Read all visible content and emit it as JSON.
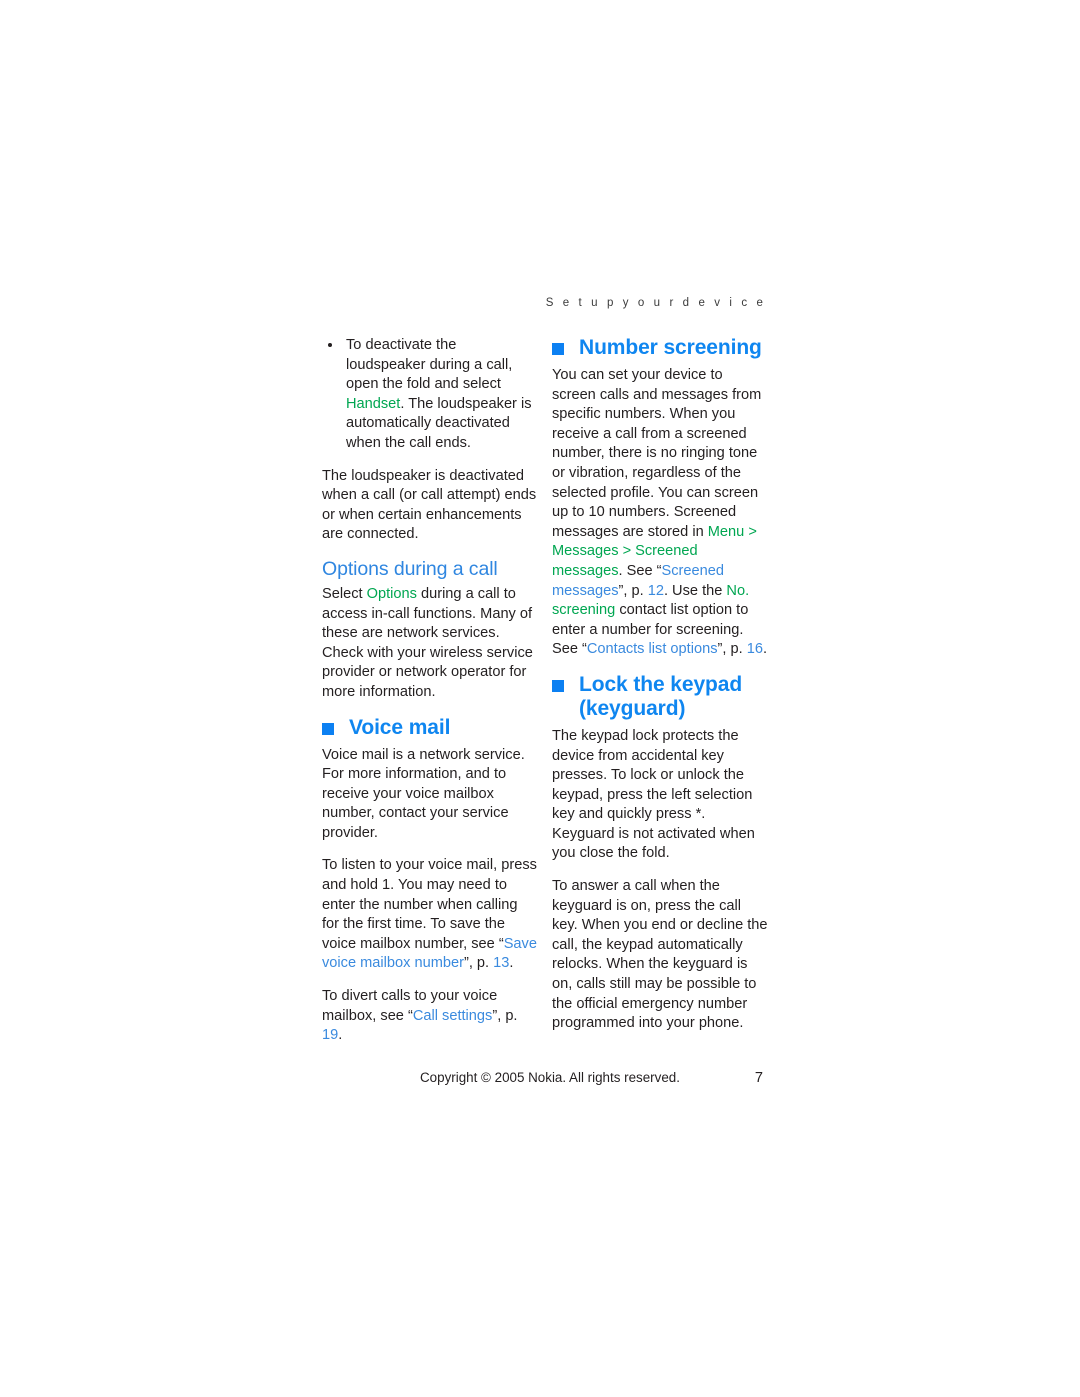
{
  "page": {
    "running_header": "S e t   u p   y o u r   d e v i c e",
    "number": "7",
    "copyright": "Copyright © 2005 Nokia. All rights reserved."
  },
  "colors": {
    "heading_blue": "#0f86f0",
    "bullet_square_blue": "#0c80f2",
    "subheading_blue": "#2f86e0",
    "link_blue": "#3a8ade",
    "ui_green": "#00a651",
    "body_text": "#231f20"
  },
  "left_column": {
    "bullet_1": {
      "part1": "To deactivate the loudspeaker during a call, open the fold and select ",
      "ui_term": "Handset",
      "part2": ". The loudspeaker is automatically deactivated when the call ends."
    },
    "paragraph_1": "The loudspeaker is deactivated when a call (or call attempt) ends or when certain enhancements are connected.",
    "subheading_options": "Options during a call",
    "paragraph_2": {
      "part1": "Select ",
      "ui_term": "Options",
      "part2": " during a call to access in-call functions. Many of these are network services. Check with your wireless service provider or network operator for more information."
    },
    "heading_voice_mail": "Voice mail",
    "paragraph_3": "Voice mail is a network service. For more information, and to receive your voice mailbox number, contact your service provider.",
    "paragraph_4": {
      "part1": "To listen to your voice mail, press and hold 1. You may need to enter the number when calling for the first time. To save the voice mailbox number, see “",
      "link1": "Save voice mailbox number",
      "part2": "”, p. ",
      "link2": "13",
      "part3": "."
    },
    "paragraph_5": {
      "part1": "To divert calls to your voice mailbox, see “",
      "link1": "Call settings",
      "part2": "”, p. ",
      "link2": "19",
      "part3": "."
    }
  },
  "right_column": {
    "heading_number_screening": "Number screening",
    "paragraph_1": {
      "part1": "You can set your device to screen calls and messages from specific numbers. When you receive a call from a screened number, there is no ringing tone or vibration, regardless of the selected profile. You can screen up to 10 numbers. Screened messages are stored in ",
      "ui_path1": "Menu",
      "sep1": " > ",
      "ui_path2": "Messages",
      "sep2": " > ",
      "ui_path3": "Screened messages",
      "part2": ". See “",
      "link1": "Screened messages",
      "part3": "”, p. ",
      "link2": "12",
      "part4": ". Use the ",
      "ui_path4": "No. screening",
      "part5": " contact list option to enter a number for screening. See “",
      "link3": "Contacts list options",
      "part6": "”, p. ",
      "link4": "16",
      "part7": "."
    },
    "heading_lock_keypad_line1": "Lock the keypad",
    "heading_lock_keypad_line2": "(keyguard)",
    "paragraph_2": "The keypad lock protects the device from accidental key presses. To lock or unlock the keypad, press the left selection key and quickly press *. Keyguard is not activated when you close the fold.",
    "paragraph_3": "To answer a call when the keyguard is on, press the call key. When you end or decline the call, the keypad automatically relocks. When the keyguard is on, calls still may be possible to the official emergency number programmed into your phone."
  }
}
